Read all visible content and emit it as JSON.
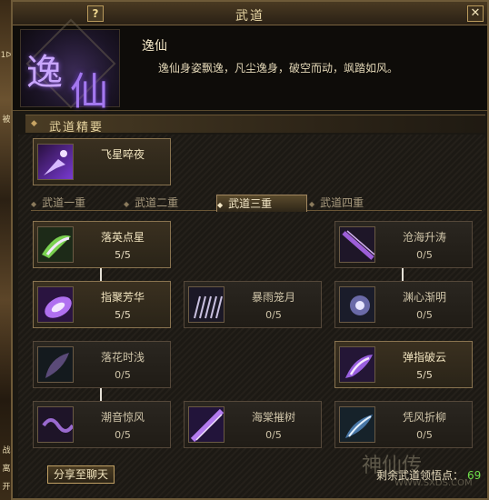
{
  "window": {
    "title": "武道",
    "help_label": "?",
    "close_label": "✕"
  },
  "background": {
    "frag1": "1ᐅ",
    "frag2": "被",
    "frag3": "战",
    "frag4": "离",
    "frag5": "开"
  },
  "header": {
    "emblem_char1": "逸",
    "emblem_char2": "仙",
    "name": "逸仙",
    "description": "逸仙身姿飘逸，凡尘逸身，破空而动，飒踏如风。"
  },
  "section": {
    "title": "武道精要"
  },
  "essence": {
    "name": "飞星啐夜"
  },
  "tabs": [
    {
      "label": "武道一重"
    },
    {
      "label": "武道二重"
    },
    {
      "label": "武道三重"
    },
    {
      "label": "武道四重"
    }
  ],
  "active_tab": 2,
  "skills": {
    "s1": {
      "name": "落英点星",
      "level": "5/5"
    },
    "s2": {
      "name": "沧海升涛",
      "level": "0/5"
    },
    "s3": {
      "name": "指聚芳华",
      "level": "5/5"
    },
    "s4": {
      "name": "暴雨笼月",
      "level": "0/5"
    },
    "s5": {
      "name": "渊心渐明",
      "level": "0/5"
    },
    "s6": {
      "name": "落花时浅",
      "level": "0/5"
    },
    "s7": {
      "name": "弹指破云",
      "level": "5/5"
    },
    "s8": {
      "name": "潮音惊风",
      "level": "0/5"
    },
    "s9": {
      "name": "海棠摧树",
      "level": "0/5"
    },
    "s10": {
      "name": "凭风折柳",
      "level": "0/5"
    }
  },
  "footer": {
    "share_label": "分享至聊天",
    "remaining_label": "剩余武道领悟点：",
    "remaining_value": "69"
  },
  "watermark": {
    "logo": "神仙传",
    "url": "WWW.SXDS.COM"
  },
  "colors": {
    "accent": "#c0a064",
    "remaining": "#6fe04a"
  }
}
